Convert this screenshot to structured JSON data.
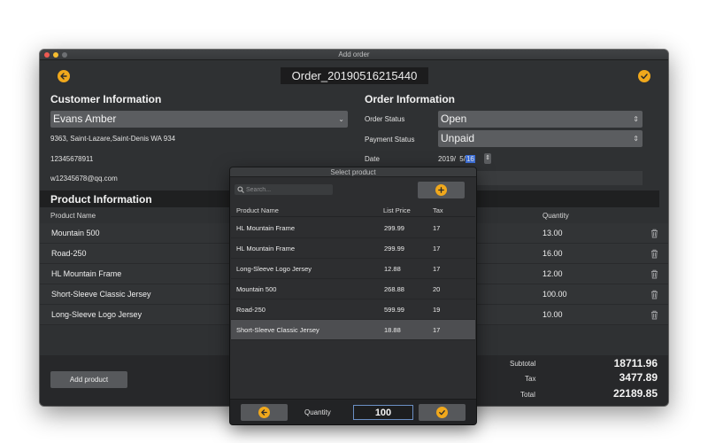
{
  "window": {
    "title": "Add order"
  },
  "header": {
    "order_name": "Order_20190516215440"
  },
  "customer": {
    "heading": "Customer Information",
    "name": "Evans Amber",
    "address": "9363, Saint-Lazare,Saint-Denis WA 934",
    "phone": "12345678911",
    "email": "w12345678@qq.com"
  },
  "order": {
    "heading": "Order Information",
    "status_label": "Order Status",
    "status_value": "Open",
    "payment_label": "Payment Status",
    "payment_value": "Unpaid",
    "date_label": "Date",
    "date_year": "2019/",
    "date_month": "5/",
    "date_day": "16"
  },
  "products": {
    "heading": "Product Information",
    "col_name": "Product Name",
    "col_quantity": "Quantity",
    "rows": [
      {
        "name": "Mountain 500",
        "quantity": "13.00"
      },
      {
        "name": "Road-250",
        "quantity": "16.00"
      },
      {
        "name": "HL Mountain Frame",
        "quantity": "12.00"
      },
      {
        "name": "Short-Sleeve Classic Jersey",
        "quantity": "100.00"
      },
      {
        "name": "Long-Sleeve Logo Jersey",
        "quantity": "10.00"
      }
    ]
  },
  "footer": {
    "add_product_label": "Add product",
    "subtotal_label": "Subtotal",
    "subtotal_value": "18711.96",
    "tax_label": "Tax",
    "tax_value": "3477.89",
    "total_label": "Total",
    "total_value": "22189.85"
  },
  "dialog": {
    "title": "Select product",
    "search_placeholder": "Search...",
    "col_name": "Product Name",
    "col_price": "List Price",
    "col_tax": "Tax",
    "rows": [
      {
        "name": "HL Mountain Frame",
        "price": "299.99",
        "tax": "17"
      },
      {
        "name": "HL Mountain Frame",
        "price": "299.99",
        "tax": "17"
      },
      {
        "name": "Long-Sleeve Logo Jersey",
        "price": "12.88",
        "tax": "17"
      },
      {
        "name": "Mountain 500",
        "price": "268.88",
        "tax": "20"
      },
      {
        "name": "Road-250",
        "price": "599.99",
        "tax": "19"
      },
      {
        "name": "Short-Sleeve Classic Jersey",
        "price": "18.88",
        "tax": "17"
      }
    ],
    "selected_row": "Short-Sleeve Classic Jersey",
    "quantity_label": "Quantity",
    "quantity_value": "100"
  },
  "colors": {
    "accent": "#f0a81c",
    "window_bg": "#2f3133",
    "selection_highlight": "#3d6fd8"
  },
  "icons": [
    "back-arrow-icon",
    "confirm-check-icon",
    "chevron-down-icon",
    "up-down-arrows-icon",
    "trash-icon",
    "search-icon",
    "add-plus-icon"
  ]
}
